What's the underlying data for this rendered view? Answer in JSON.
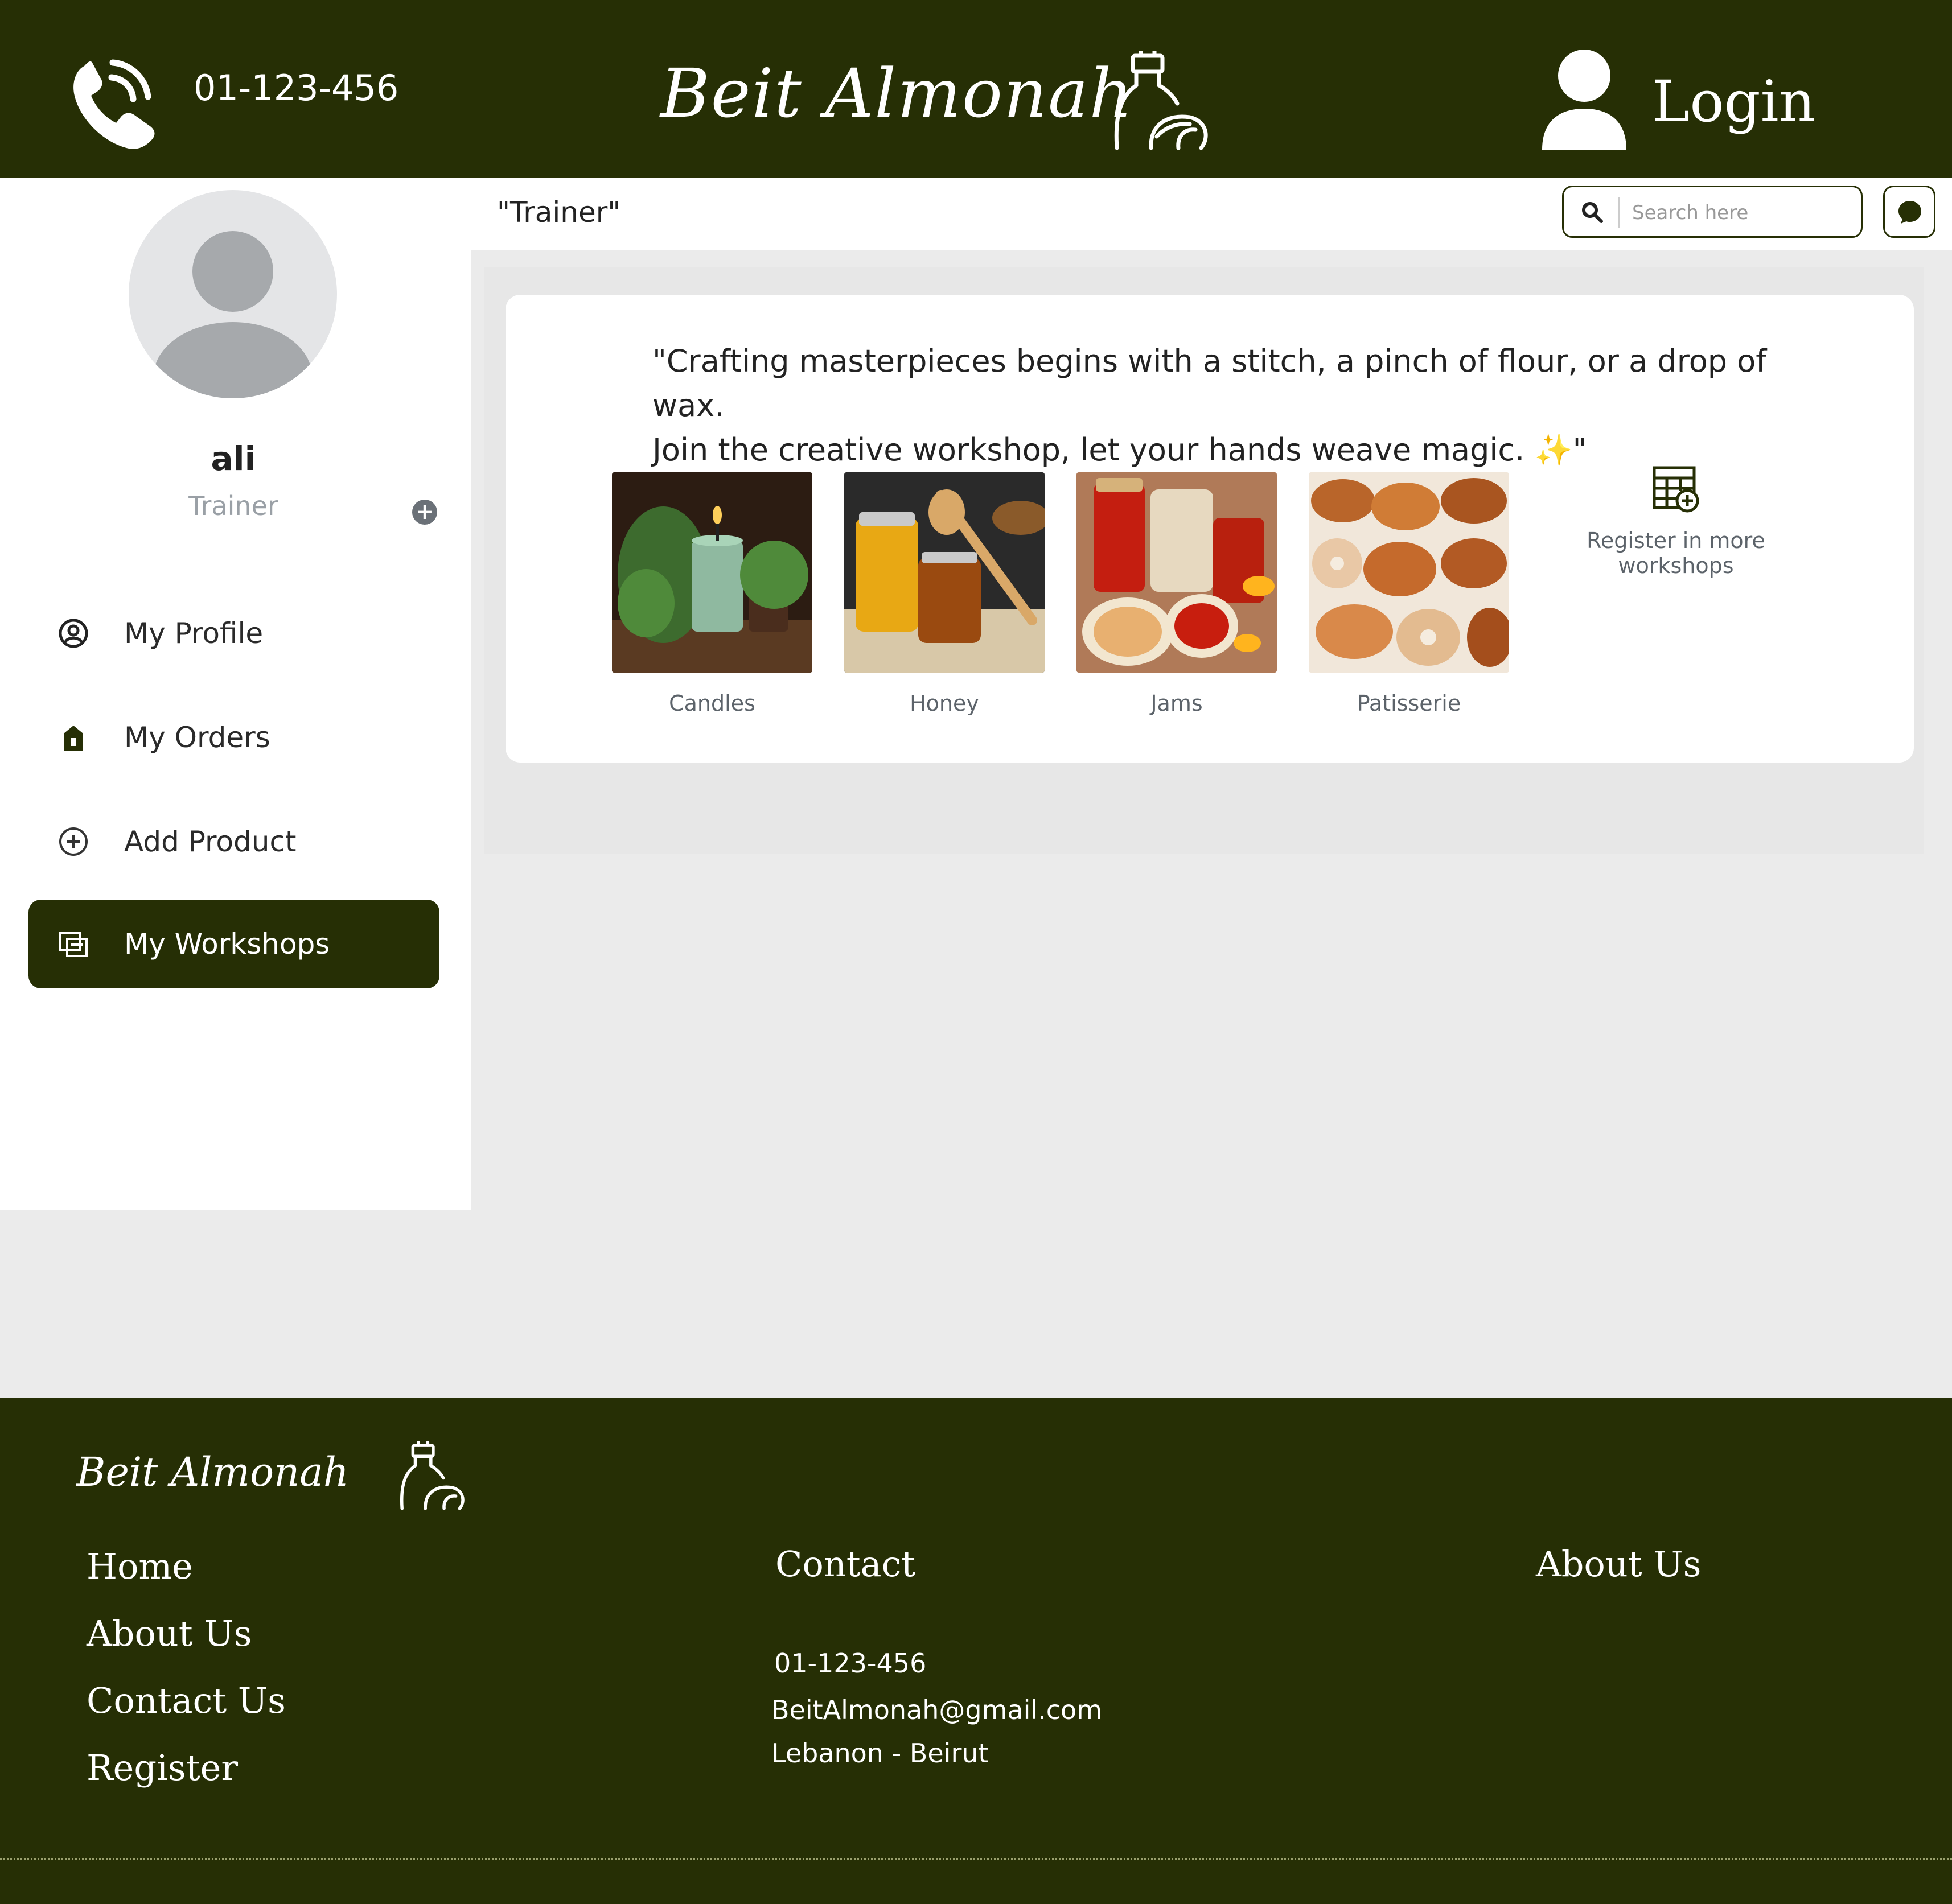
{
  "header": {
    "phone": "01-123-456",
    "brand": "Beit Almonah",
    "login_label": "Login"
  },
  "profile": {
    "name": "ali",
    "role": "Trainer"
  },
  "sidebar": {
    "items": [
      {
        "label": "My Profile",
        "icon": "user-circle-icon",
        "active": false
      },
      {
        "label": "My Orders",
        "icon": "bag-icon",
        "active": false
      },
      {
        "label": "Add Product",
        "icon": "plus-circle-icon",
        "active": false
      },
      {
        "label": "My Workshops",
        "icon": "workshop-icon",
        "active": true
      }
    ]
  },
  "main": {
    "role_title": "\"Trainer\"",
    "search_placeholder": "Search here",
    "quote_line1": "\"Crafting masterpieces begins with a stitch, a pinch of flour, or a drop of wax.",
    "quote_line2": "Join the creative workshop, let your hands weave magic. ✨\"",
    "workshops": [
      {
        "label": "Candles"
      },
      {
        "label": "Honey"
      },
      {
        "label": "Jams"
      },
      {
        "label": "Patisserie"
      }
    ],
    "register_more": "Register in more workshops"
  },
  "footer": {
    "brand": "Beit Almonah",
    "links": [
      "Home",
      "About Us",
      "Contact Us",
      "Register"
    ],
    "contact_heading": "Contact",
    "about_heading": "About Us",
    "phone": "01-123-456",
    "email": "BeitAlmonah@gmail.com",
    "address": "Lebanon - Beirut"
  },
  "colors": {
    "primary": "#262f05",
    "background": "#ebebeb",
    "muted_text": "#5c636a"
  }
}
